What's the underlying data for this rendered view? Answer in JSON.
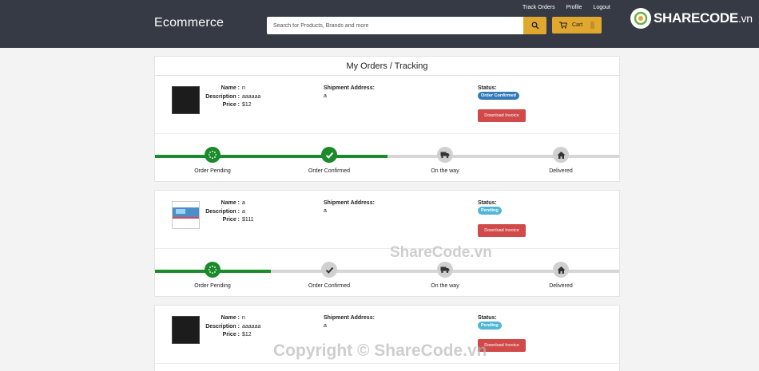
{
  "header": {
    "brand": "Ecommerce",
    "links": [
      "Track Orders",
      "Profile",
      "Logout"
    ],
    "search_placeholder": "Search for Products, Brands and more",
    "cart_label": "Cart"
  },
  "logo": {
    "name": "SHARECODE",
    "suffix": ".vn"
  },
  "page_title": "My Orders / Tracking",
  "labels": {
    "name": "Name :",
    "description": "Description :",
    "price": "Price :",
    "shipment": "Shipment Address:",
    "status": "Status:",
    "invoice": "Download Invoice"
  },
  "steps": [
    "Order Pending",
    "Order Confirmed",
    "On the way",
    "Delivered"
  ],
  "orders": [
    {
      "name": "n",
      "description": "aaaaaa",
      "price": "$12",
      "address": "a",
      "status": "Order Confirmed",
      "progress_steps": 2
    },
    {
      "name": "a",
      "description": "a",
      "price": "$111",
      "address": "a",
      "status": "Pending",
      "progress_steps": 1
    },
    {
      "name": "n",
      "description": "aaaaaa",
      "price": "$12",
      "address": "a",
      "status": "Pending",
      "progress_steps": 1
    }
  ],
  "watermarks": [
    "ShareCode.vn",
    "Copyright © ShareCode.vn"
  ],
  "colors": {
    "header_bg": "#353a44",
    "accent": "#e0a82e",
    "progress": "#1a8a2a",
    "invoice": "#d14a4a"
  },
  "icons": {
    "search": "search-icon",
    "cart": "cart-icon",
    "pending": "spinner-icon",
    "confirmed": "check-icon",
    "on_the_way": "truck-icon",
    "delivered": "home-icon"
  }
}
